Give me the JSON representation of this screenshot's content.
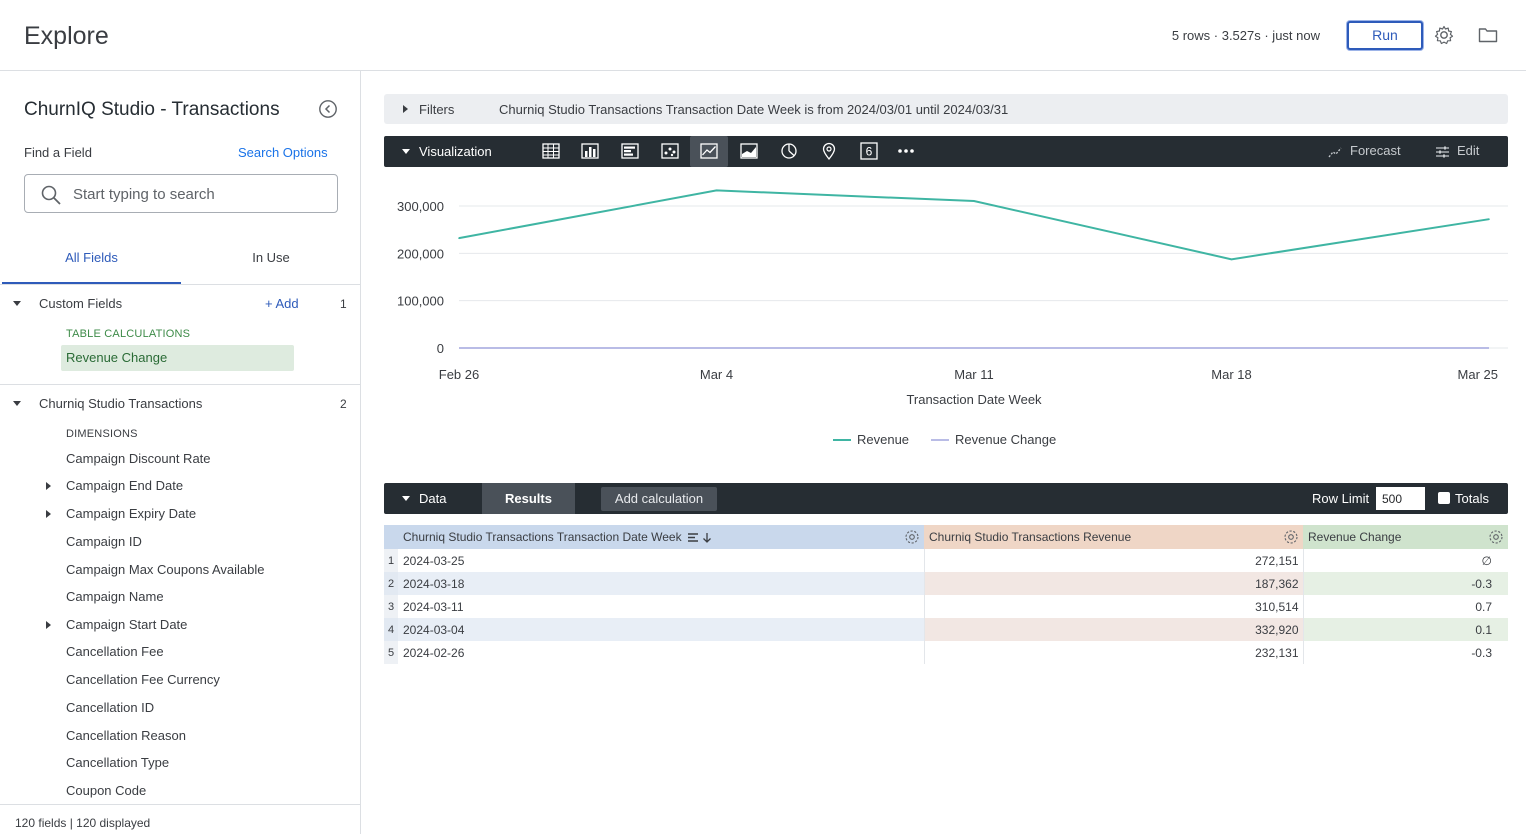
{
  "app": {
    "title": "Explore",
    "run_status": "5 rows · 3.527s · just now",
    "run_label": "Run"
  },
  "sidebar": {
    "explore_name": "ChurnIQ Studio - Transactions",
    "find_label": "Find a Field",
    "search_options": "Search Options",
    "search_placeholder": "Start typing to search",
    "tabs": [
      "All Fields",
      "In Use"
    ],
    "custom_fields": {
      "label": "Custom Fields",
      "add_label": "+ Add",
      "count": "1",
      "section": "TABLE CALCULATIONS",
      "items": [
        "Revenue Change"
      ]
    },
    "view": {
      "label": "Churniq Studio Transactions",
      "count": "2",
      "section": "DIMENSIONS",
      "fields": [
        "Campaign Discount Rate",
        "Campaign End Date",
        "Campaign Expiry Date",
        "Campaign ID",
        "Campaign Max Coupons Available",
        "Campaign Name",
        "Campaign Start Date",
        "Cancellation Fee",
        "Cancellation Fee Currency",
        "Cancellation ID",
        "Cancellation Reason",
        "Cancellation Type",
        "Coupon Code"
      ]
    },
    "footer": "120 fields | 120 displayed"
  },
  "filters": {
    "label": "Filters",
    "description": "Churniq Studio Transactions Transaction Date Week is from 2024/03/01 until 2024/03/31"
  },
  "visualization": {
    "label": "Visualization",
    "chart_types": [
      "table-icon",
      "column-icon",
      "bar-icon",
      "scatter-icon",
      "line-icon",
      "area-icon",
      "pie-icon",
      "map-pin-icon",
      "single-value-icon",
      "more-icon"
    ],
    "active_type": "line-icon",
    "forecast_label": "Forecast",
    "edit_label": "Edit"
  },
  "chart_data": {
    "type": "line",
    "x": [
      "Feb 26",
      "Mar 4",
      "Mar 11",
      "Mar 18",
      "Mar 25"
    ],
    "series": [
      {
        "name": "Revenue",
        "values": [
          232131,
          332920,
          310514,
          187362,
          272151
        ],
        "color": "#3fb5a3"
      },
      {
        "name": "Revenue Change",
        "values": [
          -0.3,
          0.1,
          0.7,
          -0.3,
          null
        ],
        "color": "#b9bce6"
      }
    ],
    "xlabel": "Transaction Date Week",
    "ylabel": "",
    "yticks": [
      "300,000",
      "200,000",
      "100,000",
      "0"
    ],
    "ylim": [
      0,
      350000
    ],
    "legend": "bottom",
    "grid": true
  },
  "data_panel": {
    "label": "Data",
    "results_label": "Results",
    "add_calc_label": "Add calculation",
    "row_limit_label": "Row Limit",
    "row_limit_value": "500",
    "totals_label": "Totals",
    "columns": [
      "Churniq Studio Transactions Transaction Date Week",
      "Churniq Studio Transactions Revenue",
      "Revenue Change"
    ],
    "rows": [
      [
        "1",
        "2024-03-25",
        "272,151",
        "∅"
      ],
      [
        "2",
        "2024-03-18",
        "187,362",
        "-0.3"
      ],
      [
        "3",
        "2024-03-11",
        "310,514",
        "0.7"
      ],
      [
        "4",
        "2024-03-04",
        "332,920",
        "0.1"
      ],
      [
        "5",
        "2024-02-26",
        "232,131",
        "-0.3"
      ]
    ]
  },
  "colors": {
    "accent": "#2e5bba",
    "dark_bar": "#262d33",
    "revenue_line": "#3fb5a3",
    "revenue_change_line": "#b9bce6"
  }
}
